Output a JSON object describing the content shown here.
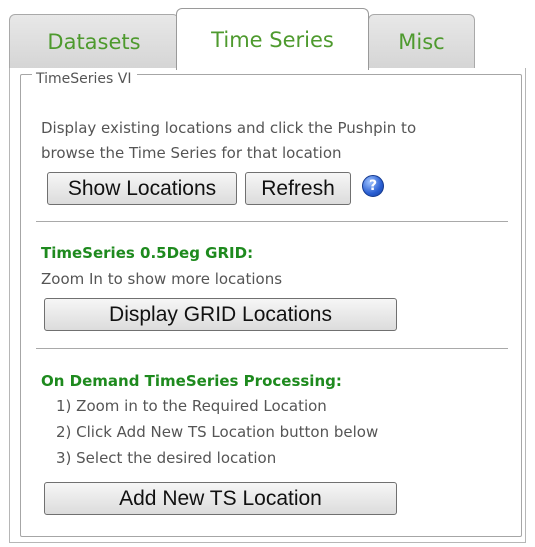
{
  "tabs": [
    {
      "label": "Datasets",
      "active": false
    },
    {
      "label": "Time Series",
      "active": true
    },
    {
      "label": "Misc",
      "active": false
    }
  ],
  "group": {
    "legend": "TimeSeries VI",
    "intro_line1": "Display existing locations and click the Pushpin to",
    "intro_line2": "browse the Time Series for that location",
    "show_locations_label": "Show Locations",
    "refresh_label": "Refresh",
    "help_icon": "help-icon",
    "help_glyph": "?"
  },
  "grid_section": {
    "title": "TimeSeries 0.5Deg GRID:",
    "subtitle": "Zoom In to show more locations",
    "button_label": "Display GRID Locations"
  },
  "ondemand_section": {
    "title": "On Demand TimeSeries Processing:",
    "steps": [
      "1) Zoom in to the Required Location",
      "2) Click Add New TS Location button below",
      "3) Select the desired location"
    ],
    "button_label": "Add New TS Location"
  },
  "colors": {
    "tab_text": "#4e9a2e",
    "section_title": "#1e8a1e",
    "help_icon": "#2a5fd3"
  }
}
